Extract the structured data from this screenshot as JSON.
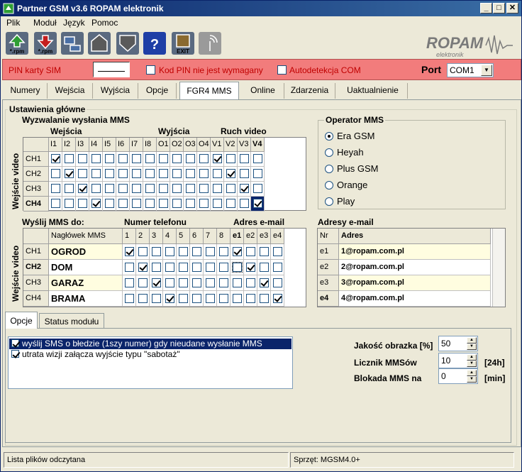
{
  "window": {
    "title": "Partner GSM v3.6 ROPAM elektronik",
    "minimize": "_",
    "maximize": "□",
    "close": "✕"
  },
  "menu": [
    "Plik",
    "Moduł",
    "Język",
    "Pomoc"
  ],
  "toolbar": {
    "icons": [
      {
        "name": "upload-rpm-icon",
        "caption": "*.rpm",
        "color": "#2e9e34"
      },
      {
        "name": "download-rpm-icon",
        "caption": "*.rpm",
        "color": "#c41e1e"
      },
      {
        "name": "connect-icon",
        "caption": "",
        "color": "#4a6fa5"
      },
      {
        "name": "write-module-icon",
        "caption": "",
        "color": "#5a5a5a"
      },
      {
        "name": "read-module-icon",
        "caption": "",
        "color": "#5a5a5a"
      },
      {
        "name": "help-icon",
        "caption": "?",
        "color": "#1f3fa6"
      },
      {
        "name": "exit-icon",
        "caption": "EXIT",
        "color": "#8a6a30"
      },
      {
        "name": "antenna-icon",
        "caption": "",
        "color": "#808080"
      }
    ],
    "logo_main": "ROPAM",
    "logo_sub": "elektronik"
  },
  "pinbar": {
    "pin_label": "PIN karty SIM",
    "no_pin_label": "Kod PIN nie jest wymagany",
    "no_pin_checked": false,
    "autodetect_label": "Autodetekcja COM",
    "autodetect_checked": false,
    "port_label": "Port",
    "port_value": "COM1",
    "bg_color": "#f27c7c"
  },
  "tabs": [
    "Numery",
    "Wejścia",
    "Wyjścia",
    "Opcje",
    "FGR4 MMS",
    "Online",
    "Zdarzenia",
    "Uaktualnienie"
  ],
  "selected_tab": "FGR4 MMS",
  "main": {
    "group_title": "Ustawienia główne",
    "trigger_title": "Wyzwalanie wysłania MMS",
    "inputs_hdr": "Wejścia",
    "outputs_hdr": "Wyjścia",
    "motion_hdr": "Ruch video",
    "video_in_label": "Wejście video",
    "trigger_cols": [
      "I1",
      "I2",
      "I3",
      "I4",
      "I5",
      "I6",
      "I7",
      "I8",
      "O1",
      "O2",
      "O3",
      "O4",
      "V1",
      "V2",
      "V3",
      "V4"
    ],
    "trigger_rows": [
      {
        "label": "CH1",
        "checks": [
          1,
          0,
          0,
          0,
          0,
          0,
          0,
          0,
          0,
          0,
          0,
          0,
          1,
          0,
          0,
          0
        ]
      },
      {
        "label": "CH2",
        "checks": [
          0,
          1,
          0,
          0,
          0,
          0,
          0,
          0,
          0,
          0,
          0,
          0,
          0,
          1,
          0,
          0
        ]
      },
      {
        "label": "CH3",
        "checks": [
          0,
          0,
          1,
          0,
          0,
          0,
          0,
          0,
          0,
          0,
          0,
          0,
          0,
          0,
          1,
          0
        ]
      },
      {
        "label": "CH4",
        "checks": [
          0,
          0,
          0,
          1,
          0,
          0,
          0,
          0,
          0,
          0,
          0,
          0,
          0,
          0,
          0,
          1
        ]
      }
    ],
    "send_title": "Wyślij MMS do:",
    "phone_hdr": "Numer telefonu",
    "email_hdr": "Adres e-mail",
    "header_col": "Nagłówek MMS",
    "send_cols": [
      "1",
      "2",
      "3",
      "4",
      "5",
      "6",
      "7",
      "8",
      "e1",
      "e2",
      "e3",
      "e4"
    ],
    "send_rows": [
      {
        "label": "CH1",
        "header": "OGROD",
        "checks": [
          1,
          0,
          0,
          0,
          0,
          0,
          0,
          0,
          1,
          0,
          0,
          0
        ]
      },
      {
        "label": "CH2",
        "header": "DOM",
        "checks": [
          0,
          1,
          0,
          0,
          0,
          0,
          0,
          0,
          0,
          1,
          0,
          0
        ]
      },
      {
        "label": "CH3",
        "header": "GARAZ",
        "checks": [
          0,
          0,
          1,
          0,
          0,
          0,
          0,
          0,
          0,
          0,
          1,
          0
        ]
      },
      {
        "label": "CH4",
        "header": "BRAMA",
        "checks": [
          0,
          0,
          0,
          1,
          0,
          0,
          0,
          0,
          0,
          0,
          0,
          1
        ]
      }
    ],
    "operator_title": "Operator MMS",
    "operators": [
      "Era GSM",
      "Heyah",
      "Plus GSM",
      "Orange",
      "Play"
    ],
    "operator_selected": "Era GSM",
    "emails_title": "Adresy e-mail",
    "emails_cols": [
      "Nr",
      "Adres"
    ],
    "emails": [
      {
        "nr": "e1",
        "addr": "1@ropam.com.pl"
      },
      {
        "nr": "e2",
        "addr": "2@ropam.com.pl"
      },
      {
        "nr": "e3",
        "addr": "3@ropam.com.pl"
      },
      {
        "nr": "e4",
        "addr": "4@ropam.com.pl"
      }
    ]
  },
  "subtabs": [
    "Opcje",
    "Status modułu"
  ],
  "options": [
    {
      "label": "wyślij SMS o błedzie (1szy numer) gdy nieudane wysłanie MMS",
      "checked": true,
      "selected": true
    },
    {
      "label": "utrata wizji załącza wyjście typu \"sabotaż\"",
      "checked": true,
      "selected": false
    }
  ],
  "fields": {
    "quality_label": "Jakość obrazka [%]",
    "quality_value": "50",
    "counter_label": "Licznik MMSów",
    "counter_value": "10",
    "counter_unit": "[24h]",
    "block_label": "Blokada MMS na",
    "block_value": "0",
    "block_unit": "[min]"
  },
  "status": {
    "left": "Lista plików odczytana",
    "right": "Sprzęt: MGSM4.0+"
  }
}
